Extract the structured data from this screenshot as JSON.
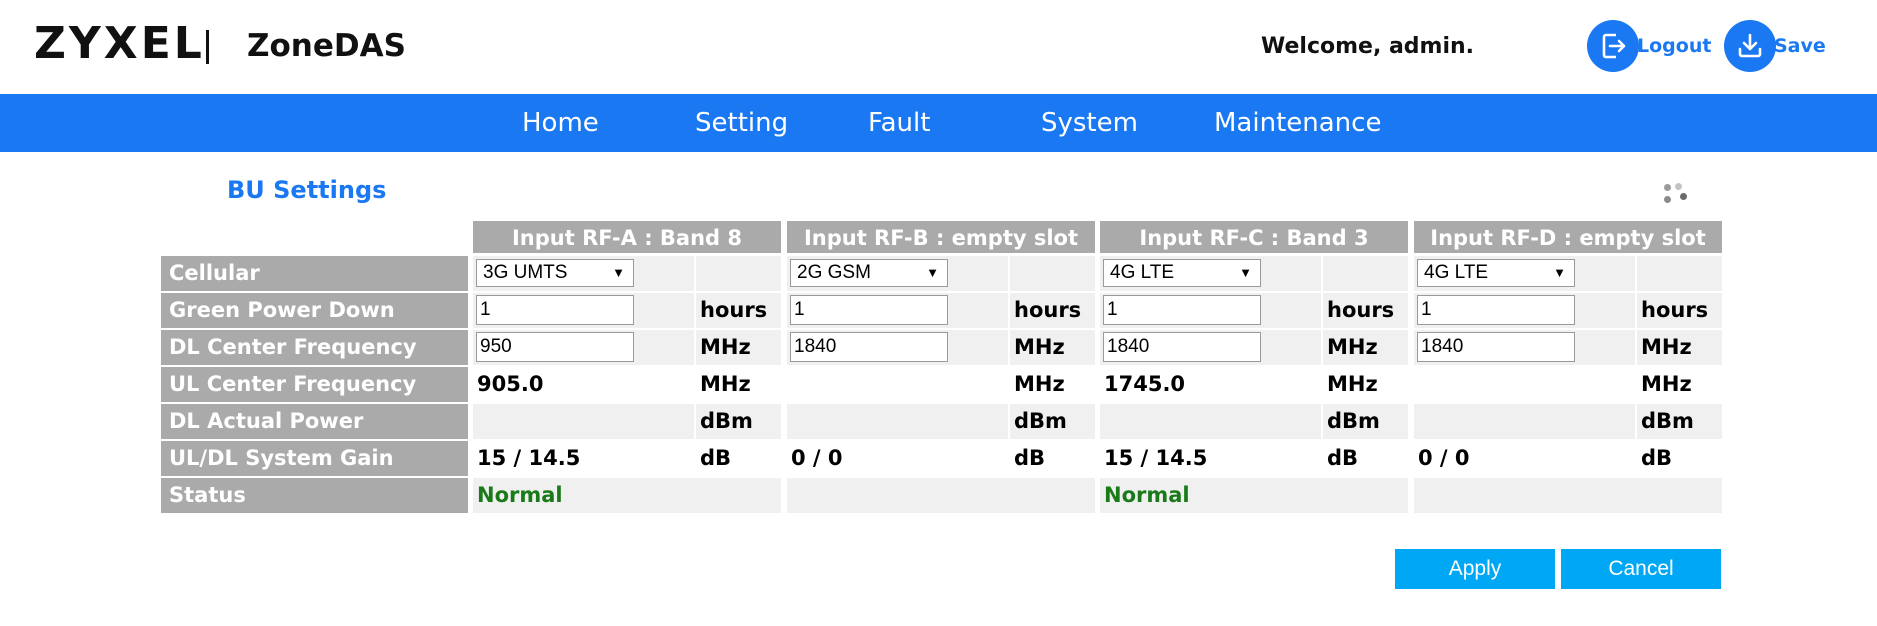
{
  "header": {
    "brand": "ZYXEL",
    "product": "ZoneDAS",
    "welcome": "Welcome, admin.",
    "logout_label": "Logout",
    "save_label": "Save"
  },
  "nav": {
    "items": [
      "Home",
      "Setting",
      "Fault",
      "System",
      "Maintenance"
    ]
  },
  "page": {
    "title": "BU Settings"
  },
  "table": {
    "columns": [
      "Input RF-A : Band 8",
      "Input RF-B : empty slot",
      "Input RF-C : Band 3",
      "Input RF-D : empty slot"
    ],
    "row_labels": [
      "Cellular",
      "Green Power Down",
      "DL Center Frequency",
      "UL Center Frequency",
      "DL Actual Power",
      "UL/DL System Gain",
      "Status"
    ],
    "units": {
      "green": "hours",
      "dl_freq": "MHz",
      "ul_freq": "MHz",
      "dl_power": "dBm",
      "gain": "dB"
    },
    "rf": [
      {
        "cellular": "3G UMTS",
        "green": "1",
        "dl_freq": "950",
        "ul_freq": "905.0",
        "dl_power": "",
        "gain": "15 / 14.5",
        "status": "Normal"
      },
      {
        "cellular": "2G GSM",
        "green": "1",
        "dl_freq": "1840",
        "ul_freq": "",
        "dl_power": "",
        "gain": "0 / 0",
        "status": ""
      },
      {
        "cellular": "4G LTE",
        "green": "1",
        "dl_freq": "1840",
        "ul_freq": "1745.0",
        "dl_power": "",
        "gain": "15 / 14.5",
        "status": "Normal"
      },
      {
        "cellular": "4G LTE",
        "green": "1",
        "dl_freq": "1840",
        "ul_freq": "",
        "dl_power": "",
        "gain": "0 / 0",
        "status": ""
      }
    ]
  },
  "actions": {
    "apply_label": "Apply",
    "cancel_label": "Cancel"
  },
  "colors": {
    "accent": "#1a78f2",
    "table_header": "#aaaaaa",
    "row_shade": "#f0f0f0",
    "status_ok": "#1a7a1a",
    "button": "#00a7f5"
  }
}
